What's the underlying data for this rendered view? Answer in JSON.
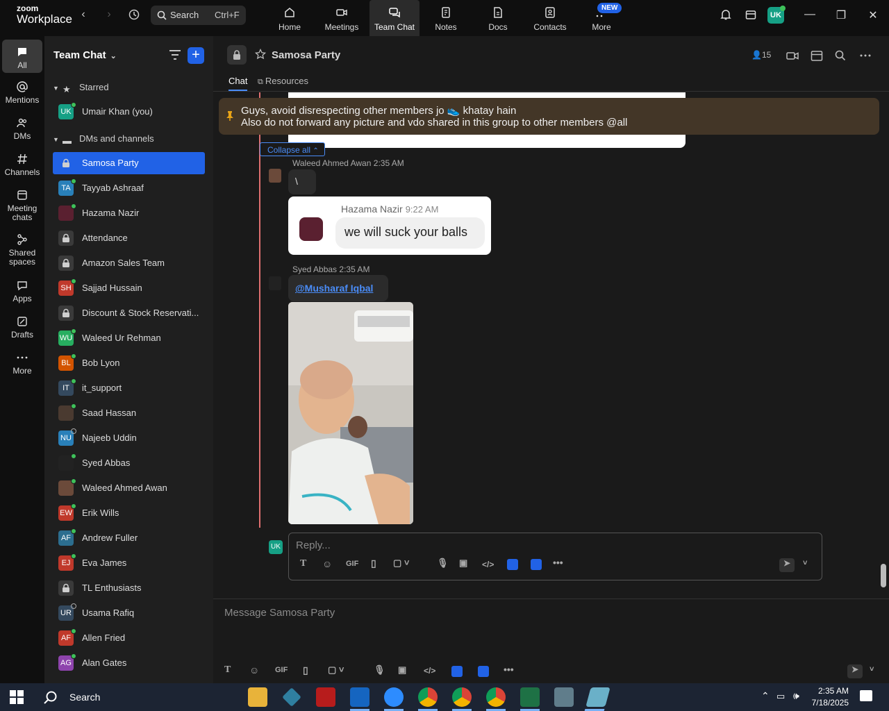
{
  "app": {
    "logo_small": "zoom",
    "logo_large": "Workplace"
  },
  "search": {
    "label": "Search",
    "shortcut": "Ctrl+F"
  },
  "nav_tabs": [
    {
      "label": "Home",
      "icon": "home-icon"
    },
    {
      "label": "Meetings",
      "icon": "camera-icon"
    },
    {
      "label": "Team Chat",
      "icon": "chat-icon",
      "active": true
    },
    {
      "label": "Notes",
      "icon": "notes-icon"
    },
    {
      "label": "Docs",
      "icon": "docs-icon"
    },
    {
      "label": "Contacts",
      "icon": "contacts-icon"
    },
    {
      "label": "More",
      "icon": "more-icon"
    }
  ],
  "new_badge": "NEW",
  "user_initials": "UK",
  "rail": [
    {
      "label": "All"
    },
    {
      "label": "Mentions"
    },
    {
      "label": "DMs"
    },
    {
      "label": "Channels"
    },
    {
      "label": "Meeting chats"
    },
    {
      "label": "Shared spaces"
    },
    {
      "label": "Apps"
    },
    {
      "label": "Drafts"
    },
    {
      "label": "More"
    }
  ],
  "sidebar": {
    "title": "Team Chat",
    "starred_label": "Starred",
    "dms_label": "DMs and channels",
    "starred": [
      {
        "name": "Umair Khan (you)",
        "initials": "UK",
        "color": "#16a085"
      }
    ],
    "items": [
      {
        "name": "Samosa Party",
        "type": "lock",
        "selected": true
      },
      {
        "name": "Tayyab Ashraaf",
        "initials": "TA",
        "color": "#2980b9",
        "status": "on"
      },
      {
        "name": "Hazama Nazir",
        "initials": "",
        "color": "#5a2030",
        "status": "on"
      },
      {
        "name": "Attendance",
        "type": "lock"
      },
      {
        "name": "Amazon Sales Team",
        "type": "lock"
      },
      {
        "name": "Sajjad Hussain",
        "initials": "SH",
        "color": "#c0392b",
        "status": "on"
      },
      {
        "name": "Discount & Stock Reservati...",
        "type": "lock"
      },
      {
        "name": "Waleed Ur Rehman",
        "initials": "WU",
        "color": "#27ae60",
        "status": "on"
      },
      {
        "name": "Bob Lyon",
        "initials": "BL",
        "color": "#d35400",
        "status": "on"
      },
      {
        "name": "it_support",
        "initials": "IT",
        "color": "#34495e",
        "status": "on"
      },
      {
        "name": "Saad Hassan",
        "initials": "",
        "color": "#4a3a30",
        "status": "on"
      },
      {
        "name": "Najeeb Uddin",
        "initials": "NU",
        "color": "#2980b9",
        "status": "off"
      },
      {
        "name": "Syed Abbas",
        "initials": "",
        "color": "#222222",
        "status": "on"
      },
      {
        "name": "Waleed Ahmed Awan",
        "initials": "",
        "color": "#6b4a3a",
        "status": "on"
      },
      {
        "name": "Erik Wills",
        "initials": "EW",
        "color": "#c0392b",
        "status": "on"
      },
      {
        "name": "Andrew Fuller",
        "initials": "AF",
        "color": "#2c6e8f",
        "status": "on"
      },
      {
        "name": "Eva James",
        "initials": "EJ",
        "color": "#c0392b",
        "status": "on"
      },
      {
        "name": "TL Enthusiasts",
        "type": "lock"
      },
      {
        "name": "Usama Rafiq",
        "initials": "UR",
        "color": "#34495e",
        "status": "off"
      },
      {
        "name": "Allen Fried",
        "initials": "AF",
        "color": "#c0392b",
        "status": "on"
      },
      {
        "name": "Alan Gates",
        "initials": "AG",
        "color": "#8e44ad",
        "status": "on"
      }
    ]
  },
  "channel": {
    "name": "Samosa Party",
    "members": "15",
    "tab_chat": "Chat",
    "tab_resources": "Resources"
  },
  "pinned": {
    "line1": "Guys, avoid disrespecting other members jo 👟 khatay hain",
    "line2": "Also do not forward any picture and vdo shared in this group to other members @all"
  },
  "collapse_label": "Collapse all",
  "messages": [
    {
      "author": "Waleed Ahmed Awan",
      "time": "2:35 AM",
      "text": "\\"
    },
    {
      "quote_author": "Hazama Nazir",
      "quote_time": "9:22 AM",
      "quote_text": "we will suck your balls"
    },
    {
      "author": "Syed Abbas",
      "time": "2:35 AM",
      "mention": "@Musharaf Iqbal"
    }
  ],
  "reply": {
    "initials": "UK",
    "placeholder": "Reply...",
    "gif": "GIF"
  },
  "composer": {
    "placeholder": "Message Samosa Party",
    "gif": "GIF"
  },
  "taskbar": {
    "search": "Search",
    "time": "2:35 AM",
    "date": "7/18/2025"
  },
  "colors": {
    "accent": "#2162e6",
    "pinned_bg": "#433627",
    "thread_line": "#e07070"
  }
}
